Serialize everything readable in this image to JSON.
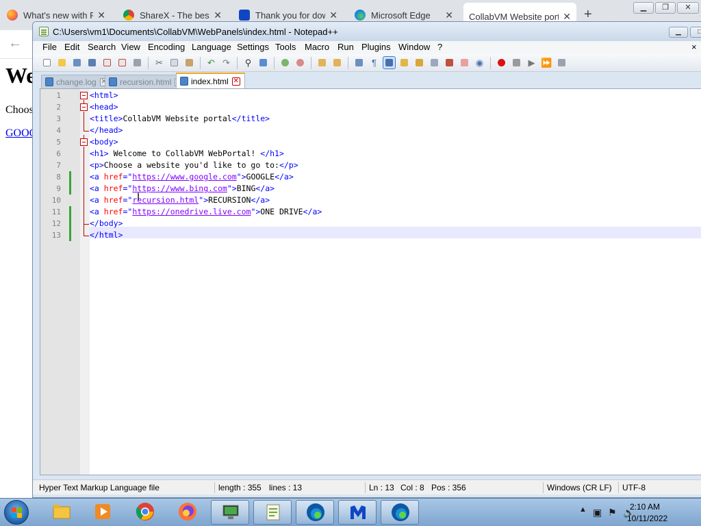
{
  "browser": {
    "tabs": [
      {
        "label": "What's new with Fire",
        "icon": "firefox-icon"
      },
      {
        "label": "ShareX - The best fre",
        "icon": "chrome-icon"
      },
      {
        "label": "Thank you for downl",
        "icon": "malwarebytes-icon"
      },
      {
        "label": "Microsoft Edge",
        "icon": "edge-icon"
      },
      {
        "label": "CollabVM Website portal",
        "icon": ""
      }
    ],
    "close_glyph": "✕",
    "new_tab_glyph": "+",
    "page": {
      "heading": "Welcome to CollabVM WebPortal!",
      "paragraph": "Choose a website you'd like to go to:",
      "link": "GOOGLE"
    }
  },
  "notepad": {
    "title": "C:\\Users\\vm1\\Documents\\CollabVM\\WebPanels\\index.html - Notepad++",
    "menu": [
      "File",
      "Edit",
      "Search",
      "View",
      "Encoding",
      "Language",
      "Settings",
      "Tools",
      "Macro",
      "Run",
      "Plugins",
      "Window",
      "?"
    ],
    "menu_close": "×",
    "file_tabs": [
      {
        "label": "change.log",
        "active": false
      },
      {
        "label": "recursion.html",
        "active": false
      },
      {
        "label": "index.html",
        "active": true
      }
    ],
    "line_numbers": [
      "1",
      "2",
      "3",
      "4",
      "5",
      "6",
      "7",
      "8",
      "9",
      "10",
      "11",
      "12",
      "13"
    ],
    "code": {
      "l1": {
        "tag": "<html>"
      },
      "l2": {
        "tag": "<head>"
      },
      "l3": {
        "open": "<title>",
        "text": "CollabVM Website portal",
        "close": "</title>"
      },
      "l4": {
        "tag": "</head>"
      },
      "l5": {
        "tag": "<body>"
      },
      "l6": {
        "open": "<h1>",
        "text": " Welcome to CollabVM WebPortal! ",
        "close": "</h1>"
      },
      "l7": {
        "open": "<p>",
        "text": "Choose a website you'd like to go to:",
        "close": "</p>"
      },
      "l8": {
        "open": "<a ",
        "attr": "href",
        "eq": "=\"",
        "val": "https://www.google.com",
        "end": "\">",
        "text": "GOOGLE",
        "close": "</a>"
      },
      "l9": {
        "open": "<a ",
        "attr": "href",
        "eq": "=\"",
        "val": "https://www.bing.com",
        "end": "\">",
        "text": "BING",
        "close": "</a>"
      },
      "l10": {
        "open": "<a ",
        "attr": "href",
        "eq": "=\"",
        "val": "recursion.html",
        "end": "\">",
        "text": "RECURSION",
        "close": "</a>"
      },
      "l11": {
        "open": "<a ",
        "attr": "href",
        "eq": "=\"",
        "val": "https://onedrive.live.com",
        "end": "\">",
        "text": "ONE DRIVE",
        "close": "</a>"
      },
      "l12": {
        "tag": "</body>"
      },
      "l13": {
        "tag": "</html>"
      }
    },
    "status": {
      "filetype": "Hyper Text Markup Language file",
      "length": "length : 355",
      "lines": "lines : 13",
      "ln": "Ln : 13",
      "col": "Col : 8",
      "pos": "Pos : 356",
      "eol": "Windows (CR LF)",
      "encoding": "UTF-8"
    }
  },
  "taskbar": {
    "apps": [
      {
        "name": "explorer",
        "icon": "folder-icon"
      },
      {
        "name": "media",
        "icon": "media-player-icon"
      },
      {
        "name": "chrome",
        "icon": "chrome-icon"
      },
      {
        "name": "firefox",
        "icon": "firefox-icon"
      },
      {
        "name": "terminal",
        "icon": "monitor-icon"
      },
      {
        "name": "notepad++",
        "icon": "notepadpp-icon"
      },
      {
        "name": "edge",
        "icon": "edge-icon"
      },
      {
        "name": "malwarebytes",
        "icon": "malwarebytes-icon"
      },
      {
        "name": "edge-2",
        "icon": "edge-icon"
      }
    ],
    "clock": {
      "time": "2:10 AM",
      "date": "10/11/2022"
    }
  },
  "colors": {
    "tag": "#0000ff",
    "attr": "#ff0000",
    "value": "#8000ff",
    "text": "#000000",
    "current_line": "#e8e8ff",
    "change_marker": "#3aa33a",
    "fold_marker": "#c00000"
  }
}
